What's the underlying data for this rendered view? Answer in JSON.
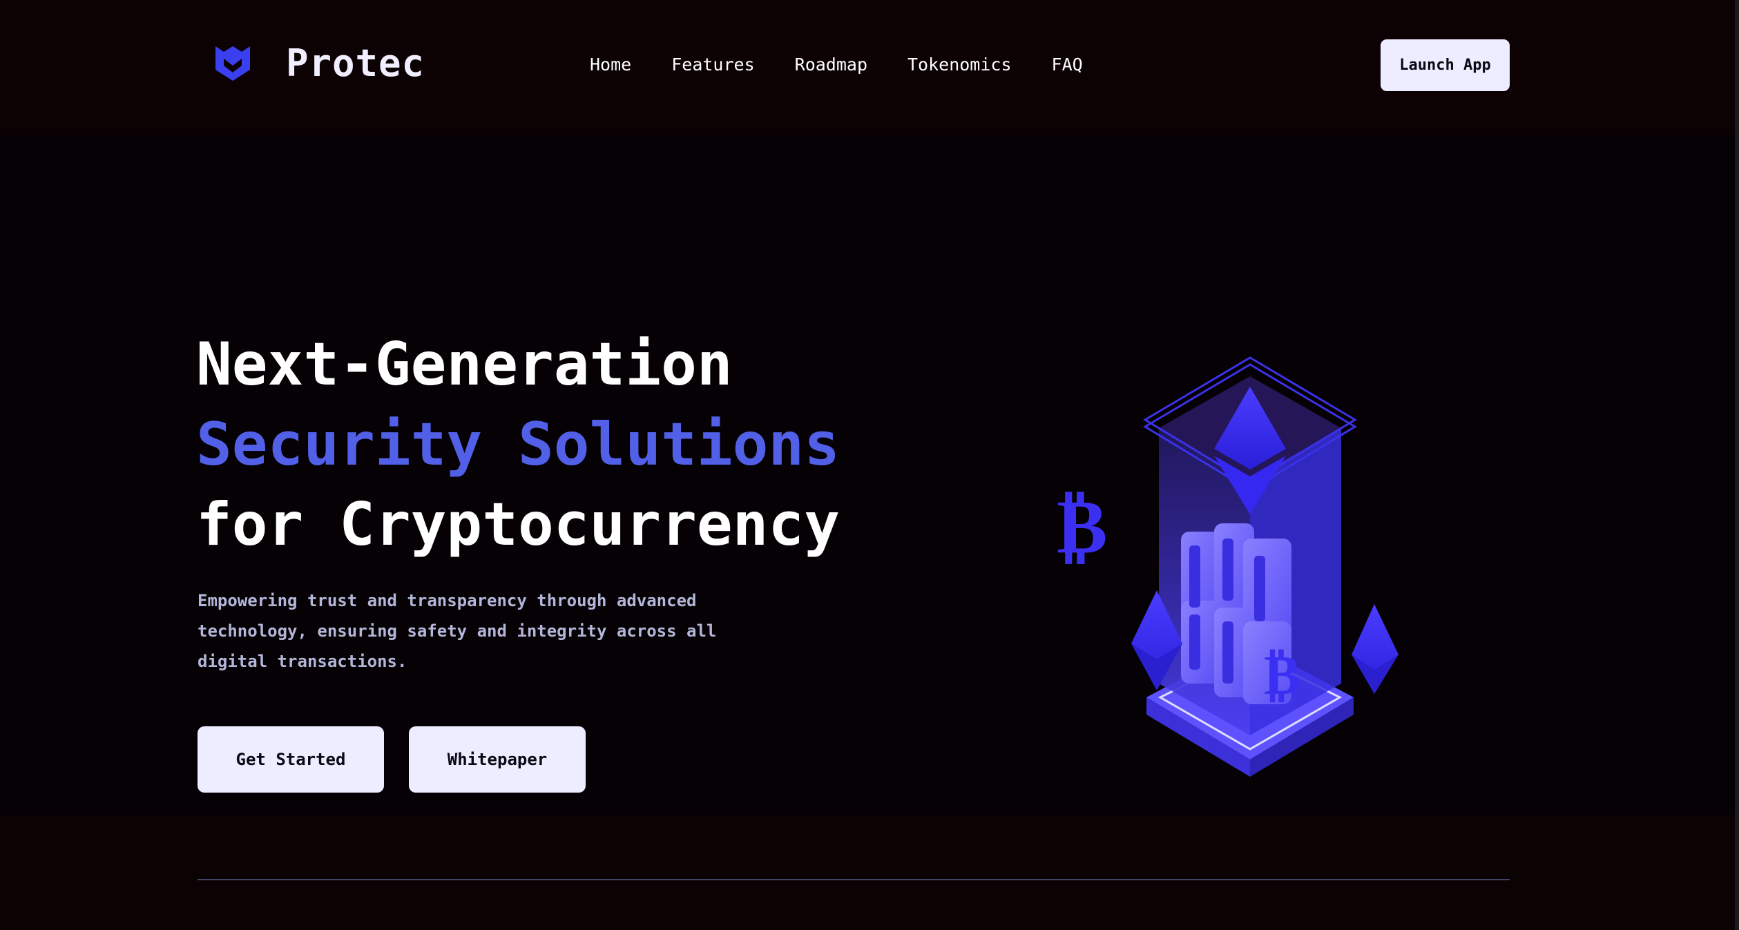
{
  "brand": {
    "name": "Protec",
    "logo_icon": "shield-icon",
    "accent_color": "#3a3ff0"
  },
  "nav": {
    "items": [
      "Home",
      "Features",
      "Roadmap",
      "Tokenomics",
      "FAQ"
    ]
  },
  "header": {
    "launch_label": "Launch App"
  },
  "hero": {
    "title_line1": "Next-Generation",
    "title_line2": "Security Solutions",
    "title_line3": "for Cryptocurrency",
    "highlight_color": "#5160e6",
    "description": "Empowering trust and transparency through advanced technology, ensuring safety and integrity across all digital transactions.",
    "primary_cta": "Get Started",
    "secondary_cta": "Whitepaper",
    "illustration": "crypto-vault-illustration"
  }
}
